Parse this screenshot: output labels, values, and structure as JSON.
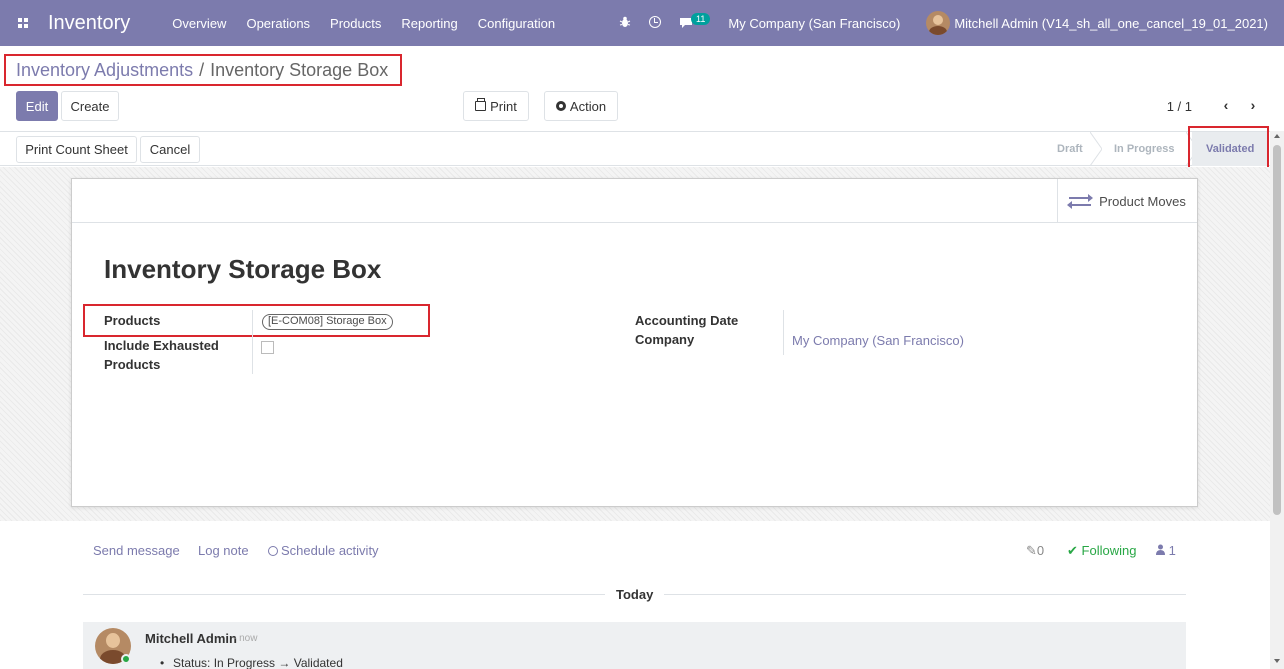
{
  "navbar": {
    "app_name": "Inventory",
    "menu": [
      "Overview",
      "Operations",
      "Products",
      "Reporting",
      "Configuration"
    ],
    "chat_count": "11",
    "company": "My Company (San Francisco)",
    "user": "Mitchell Admin (V14_sh_all_one_cancel_19_01_2021)"
  },
  "breadcrumb": {
    "parent": "Inventory Adjustments",
    "separator": "/",
    "current": "Inventory Storage Box"
  },
  "buttons": {
    "edit": "Edit",
    "create": "Create",
    "print": "Print",
    "action": "Action",
    "print_count_sheet": "Print Count Sheet",
    "cancel": "Cancel"
  },
  "pager": {
    "value": "1 / 1",
    "prev": "‹",
    "next": "›"
  },
  "statusbar": {
    "stages": [
      "Draft",
      "In Progress",
      "Validated"
    ],
    "active": "Validated"
  },
  "form": {
    "product_moves": "Product Moves",
    "title": "Inventory Storage Box",
    "products_label": "Products",
    "products_tag": "[E-COM08] Storage Box",
    "include_exhausted_label_1": "Include Exhausted",
    "include_exhausted_label_2": "Products",
    "accounting_date_label": "Accounting Date",
    "company_label": "Company",
    "company_value": "My Company (San Francisco)"
  },
  "chatter": {
    "send_message": "Send message",
    "log_note": "Log note",
    "schedule_activity": "Schedule activity",
    "attachments": "0",
    "following": "Following",
    "followers": "1",
    "today": "Today",
    "message": {
      "author": "Mitchell Admin",
      "time": "- now",
      "tracking": "Status: In Progress → Validated"
    }
  },
  "colors": {
    "brand": "#7c7bad",
    "highlight": "#d9262e",
    "following": "#28a745"
  }
}
